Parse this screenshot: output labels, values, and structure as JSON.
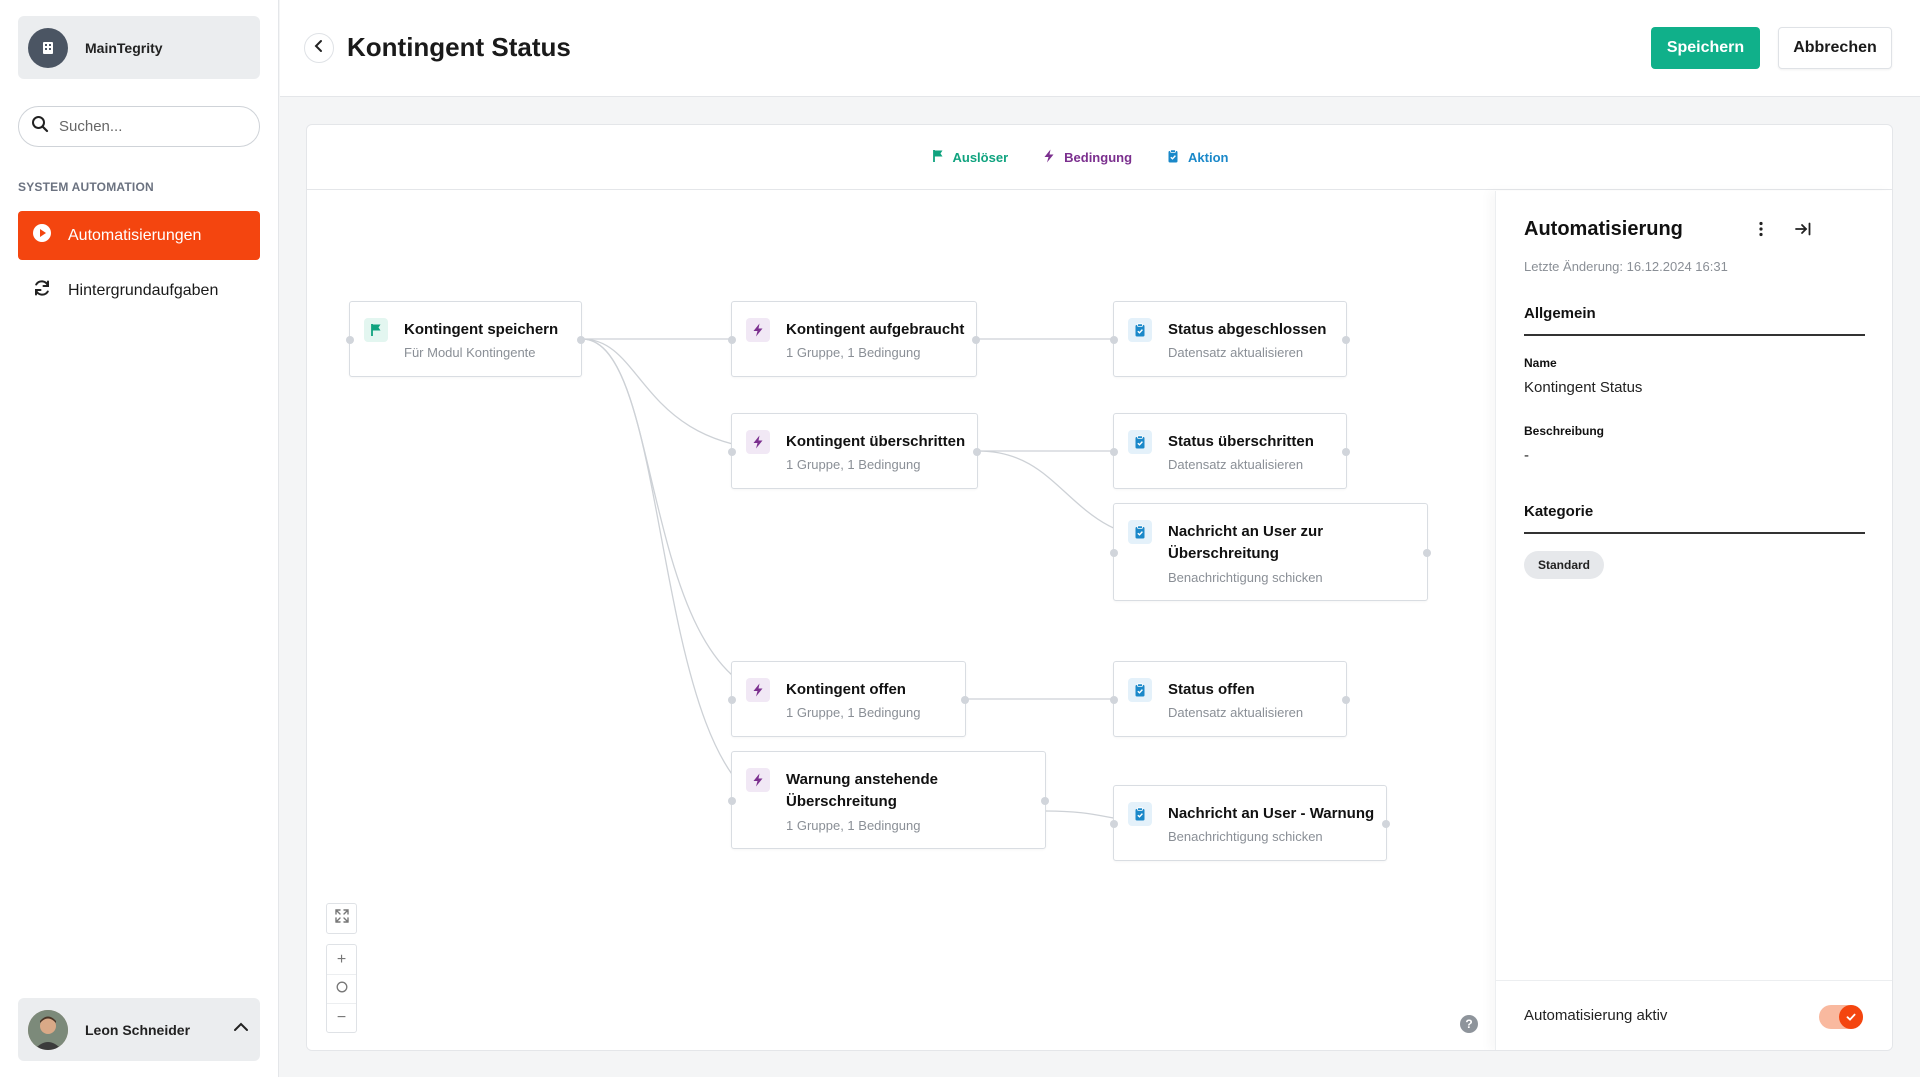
{
  "app": {
    "org_name": "MainTegrity",
    "search_placeholder": "Suchen...",
    "section_label": "SYSTEM AUTOMATION",
    "nav": [
      {
        "label": "Automatisierungen"
      },
      {
        "label": "Hintergrundaufgaben"
      }
    ],
    "user_name": "Leon Schneider"
  },
  "header": {
    "title": "Kontingent Status",
    "save_label": "Speichern",
    "cancel_label": "Abbrechen"
  },
  "legend": {
    "trigger": "Auslöser",
    "condition": "Bedingung",
    "action": "Aktion"
  },
  "colors": {
    "accent": "#f4450f",
    "save": "#10b08a",
    "trigger": "#10a37f",
    "condition": "#7b2f8e",
    "action": "#1a88c9"
  },
  "flow": {
    "trigger": {
      "title": "Kontingent speichern",
      "sub": "Für Modul Kontingente"
    },
    "conditions": [
      {
        "title": "Kontingent aufgebraucht",
        "sub": "1 Gruppe, 1 Bedingung"
      },
      {
        "title": "Kontingent überschritten",
        "sub": "1 Gruppe, 1 Bedingung"
      },
      {
        "title": "Kontingent offen",
        "sub": "1 Gruppe, 1 Bedingung"
      },
      {
        "title": "Warnung anstehende Überschreitung",
        "sub": "1 Gruppe, 1 Bedingung"
      }
    ],
    "actions": [
      {
        "title": "Status abgeschlossen",
        "sub": "Datensatz aktualisieren"
      },
      {
        "title": "Status überschritten",
        "sub": "Datensatz aktualisieren"
      },
      {
        "title": "Nachricht an User zur Überschreitung",
        "sub": "Benachrichtigung schicken"
      },
      {
        "title": "Status offen",
        "sub": "Datensatz aktualisieren"
      },
      {
        "title": "Nachricht an User - Warnung",
        "sub": "Benachrichtigung schicken"
      }
    ]
  },
  "controls": {
    "zoom_in": "+",
    "zoom_out": "−",
    "help": "?"
  },
  "panel": {
    "title": "Automatisierung",
    "meta": "Letzte Änderung: 16.12.2024 16:31",
    "general_label": "Allgemein",
    "name_label": "Name",
    "name_value": "Kontingent Status",
    "description_label": "Beschreibung",
    "description_value": "-",
    "category_label": "Kategorie",
    "category_value": "Standard",
    "active_label": "Automatisierung aktiv",
    "active": true
  }
}
